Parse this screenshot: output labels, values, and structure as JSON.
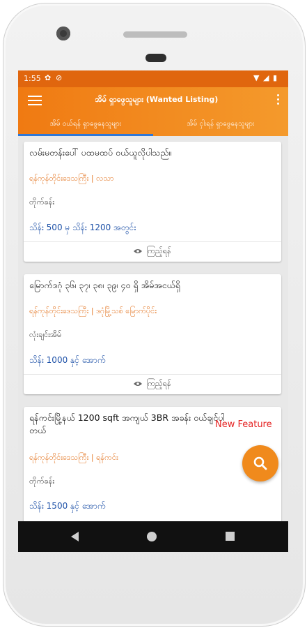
{
  "status_bar": {
    "time": "1:55"
  },
  "app_bar": {
    "title": "အိမ် ရှာဖွေသူများ (Wanted Listing)"
  },
  "tabs": [
    {
      "label": "အိမ် ဝယ်ရန် ရှာဖွေနေသူများ"
    },
    {
      "label": "အိမ် ငှါးရန် ရှာဖွေနေသူများ"
    }
  ],
  "listings": [
    {
      "title": "လမ်းမတန်းပေါ် ပထမထပ် ဝယ်ယူလိုပါသည်။",
      "location": "ရန်ကုန်တိုင်းဒေသကြီး | လသာ",
      "property_type": "တိုက်ခန်း",
      "price": "သိန်း 500 မှ သိန်း 1200 အတွင်း",
      "view_label": "ကြည့်ရန်"
    },
    {
      "title": "မြောက်ဒဂုံ ၃၆၊ ၃၇၊ ၃၈၊ ၃၉၊ ၄၀ ရှိ အိမ်အငယ်ရှိ",
      "location": "ရန်ကုန်တိုင်းဒေသကြီး | ဒဂုံမြို့သစ် မြောက်ပိုင်း",
      "property_type": "လုံးချင်းအိမ်",
      "price": "သိန်း 1000 နှင့် အောက်",
      "view_label": "ကြည့်ရန်"
    },
    {
      "title": "ရန်ကင်းမြို့နယ် 1200 sqft အကျယ် 3BR အခန်း ဝယ်ချင်ပါတယ်",
      "location": "ရန်ကုန်တိုင်းဒေသကြီး | ရန်ကင်း",
      "property_type": "တိုက်ခန်း",
      "price": "သိန်း 1500 နှင့် အောက်"
    }
  ],
  "new_feature_label": "New Feature",
  "fab": {
    "icon": "search-icon"
  },
  "colors": {
    "primary": "#f07a12",
    "status_bar": "#e0660e",
    "location_text": "#e47a2a",
    "price_text": "#1f52a8",
    "tab_indicator": "#2f77d6",
    "new_feature": "#e52222"
  }
}
